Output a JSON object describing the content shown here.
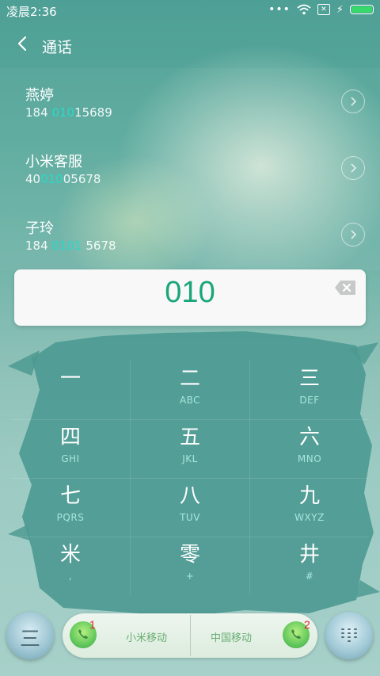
{
  "status": {
    "time": "凌晨2:36",
    "more": "•••"
  },
  "header": {
    "title": "通话"
  },
  "contacts": [
    {
      "name": "燕婷",
      "num_pre": "184 ",
      "num_hl": "010",
      "num_post": "15689"
    },
    {
      "name": "小米客服",
      "num_pre": "40",
      "num_hl": "010",
      "num_post": "05678"
    },
    {
      "name": "子玲",
      "num_pre": "184 ",
      "num_hl": "0101",
      "num_post": " 5678"
    }
  ],
  "input": {
    "digits": "010"
  },
  "keypad": [
    {
      "main": "一",
      "sub": ""
    },
    {
      "main": "二",
      "sub": "ABC"
    },
    {
      "main": "三",
      "sub": "DEF"
    },
    {
      "main": "四",
      "sub": "GHI"
    },
    {
      "main": "五",
      "sub": "JKL"
    },
    {
      "main": "六",
      "sub": "MNO"
    },
    {
      "main": "七",
      "sub": "PQRS"
    },
    {
      "main": "八",
      "sub": "TUV"
    },
    {
      "main": "九",
      "sub": "WXYZ"
    },
    {
      "main": "米",
      "sub": ","
    },
    {
      "main": "零",
      "sub": "+"
    },
    {
      "main": "井",
      "sub": "#"
    }
  ],
  "bottom": {
    "menu_icon": "三",
    "sim1_label": "小米移动",
    "sim1_number": "1",
    "sim2_label": "中国移动",
    "sim2_number": "2"
  },
  "colors": {
    "highlight": "#29d9c9",
    "digits": "#1aa57a",
    "sim_number": "#e6232d"
  }
}
